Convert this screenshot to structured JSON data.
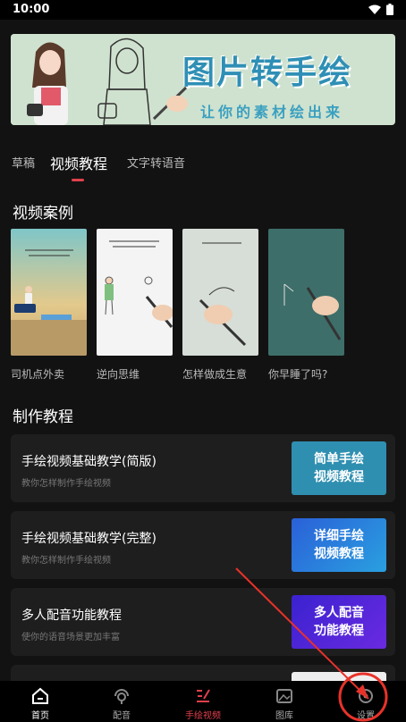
{
  "status": {
    "time": "10:00"
  },
  "banner": {
    "title": "图片转手绘",
    "subtitle": "让你的素材绘出来"
  },
  "tabs": [
    {
      "label": "草稿"
    },
    {
      "label": "视频教程"
    },
    {
      "label": "文字转语音"
    }
  ],
  "video_cases": {
    "title": "视频案例",
    "items": [
      {
        "label": "司机点外卖"
      },
      {
        "label": "逆向思维"
      },
      {
        "label": "怎样做成生意"
      },
      {
        "label": "你早睡了吗?"
      }
    ]
  },
  "tutorials": {
    "title": "制作教程",
    "items": [
      {
        "title": "手绘视频基础教学(简版)",
        "subtitle": "教你怎样制作手绘视频",
        "button": "简单手绘\n视频教程",
        "color": "#2f8fb0"
      },
      {
        "title": "手绘视频基础教学(完整)",
        "subtitle": "教你怎样制作手绘视频",
        "button": "详细手绘\n视频教程",
        "color": "#2d7fd6"
      },
      {
        "title": "多人配音功能教程",
        "subtitle": "使你的语音场景更加丰富",
        "button": "多人配音\n功能教程",
        "color": "#3a2bd8"
      }
    ]
  },
  "bottom_nav": [
    {
      "label": "首页",
      "icon": "home-icon"
    },
    {
      "label": "配音",
      "icon": "dubbing-icon"
    },
    {
      "label": "手绘视频",
      "icon": "hand-drawn-video-icon"
    },
    {
      "label": "图库",
      "icon": "gallery-icon"
    },
    {
      "label": "设置",
      "icon": "settings-icon"
    }
  ],
  "colors": {
    "accent": "#e0404c",
    "background": "#121212",
    "card": "#1e1e1e",
    "annotation": "#e8322a"
  }
}
